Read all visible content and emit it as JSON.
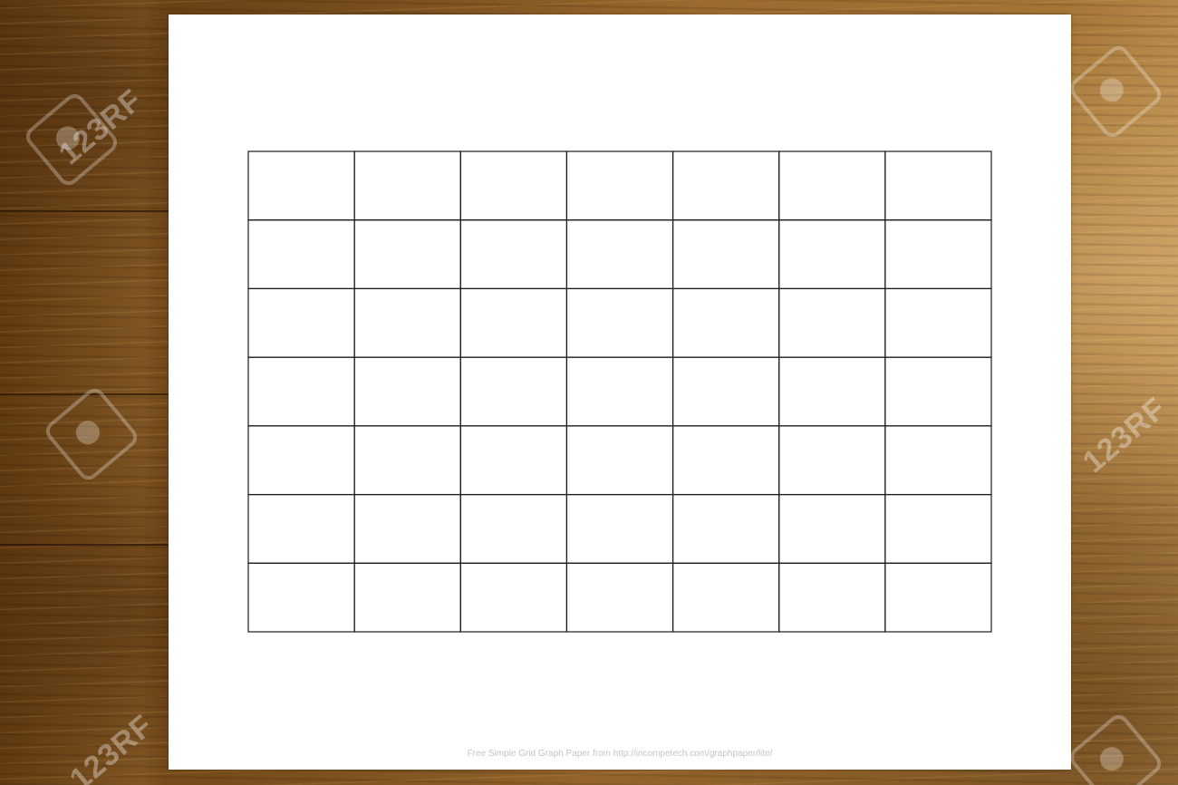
{
  "scene": {
    "background": "wood-texture",
    "wood_colors": [
      "#6e4414",
      "#9a6a2e",
      "#a47536",
      "#b58748"
    ]
  },
  "watermarks": [
    {
      "text": "123RF"
    },
    {
      "text": "123RF"
    },
    {
      "text": "123RF"
    },
    {
      "text": "123RF"
    }
  ],
  "paper": {
    "background": "#ffffff",
    "grid": {
      "columns": 7,
      "rows": 7,
      "line_color": "#1a1a1a"
    },
    "footer": "Free Simple Grid Graph Paper from http://incompetech.com/graphpaper/lite/"
  }
}
